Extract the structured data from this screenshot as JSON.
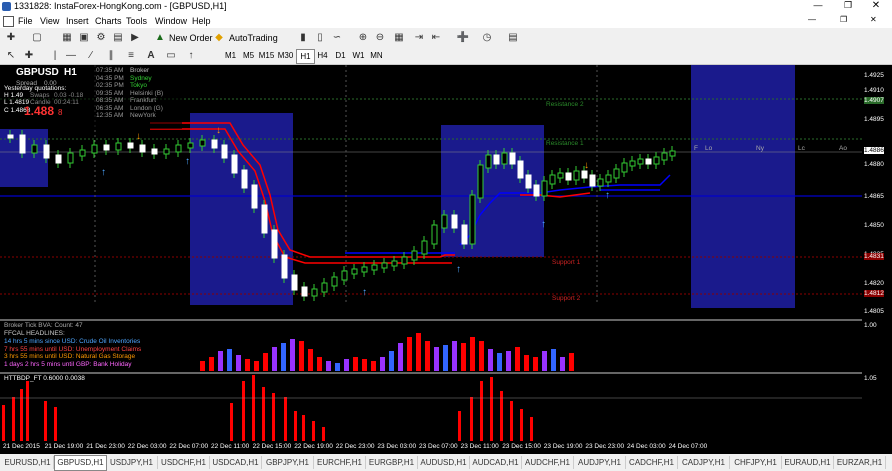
{
  "window": {
    "title": "1331828: InstaForex-HongKong.com - [GBPUSD,H1]"
  },
  "menu": [
    "File",
    "View",
    "Insert",
    "Charts",
    "Tools",
    "Window",
    "Help"
  ],
  "toolbar": {
    "new_order": "New Order",
    "autotrading": "AutoTrading"
  },
  "timeframes": [
    "M1",
    "M5",
    "M15",
    "M30",
    "H1",
    "H4",
    "D1",
    "W1",
    "MN"
  ],
  "active_timeframe": "H1",
  "symbol_panel": {
    "symbol": "GBPUSD",
    "tf": "H1",
    "spread_label": "Spread",
    "spread_value": "0.00",
    "yesterday_label": "Yesterday quotations:",
    "swaps_label": "Swaps",
    "swaps_values": "0.03   -0.18",
    "candle_label": "Candle",
    "candle_time": "00:24:11",
    "h": "H 1.49",
    "l": "L 1.4819",
    "c": "C 1.4868",
    "price_big": "1.488",
    "price_small": "8",
    "sessions": [
      {
        "time": "07:35 AM",
        "name": "Broker",
        "color": "#bbbbbb"
      },
      {
        "time": "04:35 PM",
        "name": "Sydney",
        "color": "#33cc33"
      },
      {
        "time": "02:35 PM",
        "name": "Tokyo",
        "color": "#33cc33"
      },
      {
        "time": "09:35 AM",
        "name": "Helsinki (B)",
        "color": "#999999"
      },
      {
        "time": "08:35 AM",
        "name": "Frankfurt",
        "color": "#999999"
      },
      {
        "time": "06:35 AM",
        "name": "London (G)",
        "color": "#999999"
      },
      {
        "time": "12:35 AM",
        "name": "NewYork",
        "color": "#999999"
      }
    ]
  },
  "levels": {
    "resistance2": "Resistance 2",
    "resistance1": "Resistance 1",
    "support1": "Support 1",
    "support2": "Support 2"
  },
  "session_markers": [
    "F",
    "Lo",
    "Ny",
    "Lc",
    "Ao"
  ],
  "price_axis": [
    "1.4925",
    "1.4910",
    "1.4895",
    "1.4880",
    "1.4865",
    "1.4850",
    "1.4835",
    "1.4820",
    "1.4805"
  ],
  "price_tags": {
    "r2": "1.4907",
    "current": "1.4886",
    "support1": "1.4831",
    "support2": "1.4812"
  },
  "subwin1": {
    "title": "Broker Tick BVA:  Count: 47",
    "headlines_title": "FFCAL HEADLINES:",
    "headlines": [
      {
        "text": "14 hrs 5 mins since USD: Crude Oil Inventories",
        "color": "#4da6ff"
      },
      {
        "text": "7 hrs 55 mins until USD: Unemployment Claims",
        "color": "#ff4444"
      },
      {
        "text": "3 hrs 55 mins until USD: Natural Gas Storage",
        "color": "#ff9900"
      },
      {
        "text": "1 days 2 hrs 5 mins until GBP: Bank Holiday",
        "color": "#ff66ff"
      }
    ],
    "scale": "1.00"
  },
  "subwin2": {
    "title": "HTTBDP_FT  0.6000  0.0038",
    "scale": "1.05"
  },
  "time_axis": [
    "21 Dec 2015",
    "21 Dec 19:00",
    "21 Dec 23:00",
    "22 Dec 03:00",
    "22 Dec 07:00",
    "22 Dec 11:00",
    "22 Dec 15:00",
    "22 Dec 19:00",
    "22 Dec 23:00",
    "23 Dec 03:00",
    "23 Dec 07:00",
    "23 Dec 11:00",
    "23 Dec 15:00",
    "23 Dec 19:00",
    "23 Dec 23:00",
    "24 Dec 03:00",
    "24 Dec 07:00"
  ],
  "symbol_tabs": [
    "EURUSD,H1",
    "GBPUSD,H1",
    "USDJPY,H1",
    "USDCHF,H1",
    "USDCAD,H1",
    "GBPJPY,H1",
    "EURCHF,H1",
    "EURGBP,H1",
    "AUDUSD,H1",
    "AUDCAD,H1",
    "AUDCHF,H1",
    "AUDJPY,H1",
    "CADCHF,H1",
    "CADJPY,H1",
    "CHFJPY,H1",
    "EURAUD,H1",
    "EURZAR,H1"
  ],
  "active_tab": "GBPUSD,H1",
  "colors": {
    "bull": "#ffffff",
    "bear": "#ffffff",
    "candle_up": "#33cc33",
    "zone": "#1a1a8c",
    "red_line": "#ff0000",
    "blue_line": "#0000ff"
  }
}
